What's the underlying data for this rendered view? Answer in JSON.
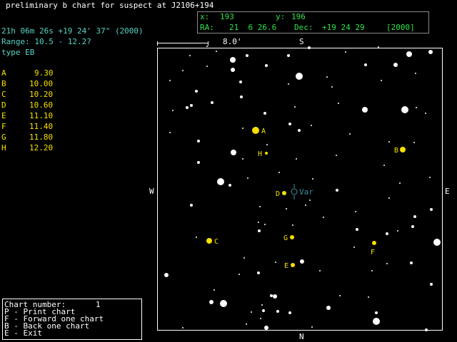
{
  "header": {
    "title": "preliminary b chart for suspect at J2106+194",
    "coords": "21h 06m 26s +19 24' 37\" (2000)",
    "range": "Range: 10.5 - 12.2?",
    "type": "type EB"
  },
  "coord_readout": {
    "x_label": "x:",
    "x_value": "193",
    "y_label": "y:",
    "y_value": "196",
    "ra_label": "RA:",
    "ra_value": "21  6 26.6",
    "dec_label": "Dec:",
    "dec_value": "+19 24 29",
    "epoch": "[2000]"
  },
  "comparison_stars": [
    {
      "letter": "A",
      "mag": "9.30"
    },
    {
      "letter": "B",
      "mag": "10.00"
    },
    {
      "letter": "C",
      "mag": "10.20"
    },
    {
      "letter": "D",
      "mag": "10.60"
    },
    {
      "letter": "E",
      "mag": "11.10"
    },
    {
      "letter": "F",
      "mag": "11.40"
    },
    {
      "letter": "G",
      "mag": "11.80"
    },
    {
      "letter": "H",
      "mag": "12.20"
    }
  ],
  "chart": {
    "scale_label": "8.0'",
    "dir_top": "S",
    "dir_bottom": "N",
    "dir_left": "W",
    "dir_right": "E",
    "variable_label": "Var"
  },
  "menu": {
    "chart_number_label": "Chart number:",
    "chart_number": "1",
    "items": [
      {
        "key": "P",
        "label": "P - Print chart"
      },
      {
        "key": "F",
        "label": "F - Forward one chart"
      },
      {
        "key": "B",
        "label": "B - Back one chart"
      },
      {
        "key": "E",
        "label": "E - Exit"
      }
    ]
  },
  "colors": {
    "background": "#000000",
    "star": "#ffffff",
    "comparison": "#f5e000",
    "header_text": "#55d6c6",
    "readout_text": "#2be34a",
    "variable": "#3a8fa0"
  }
}
